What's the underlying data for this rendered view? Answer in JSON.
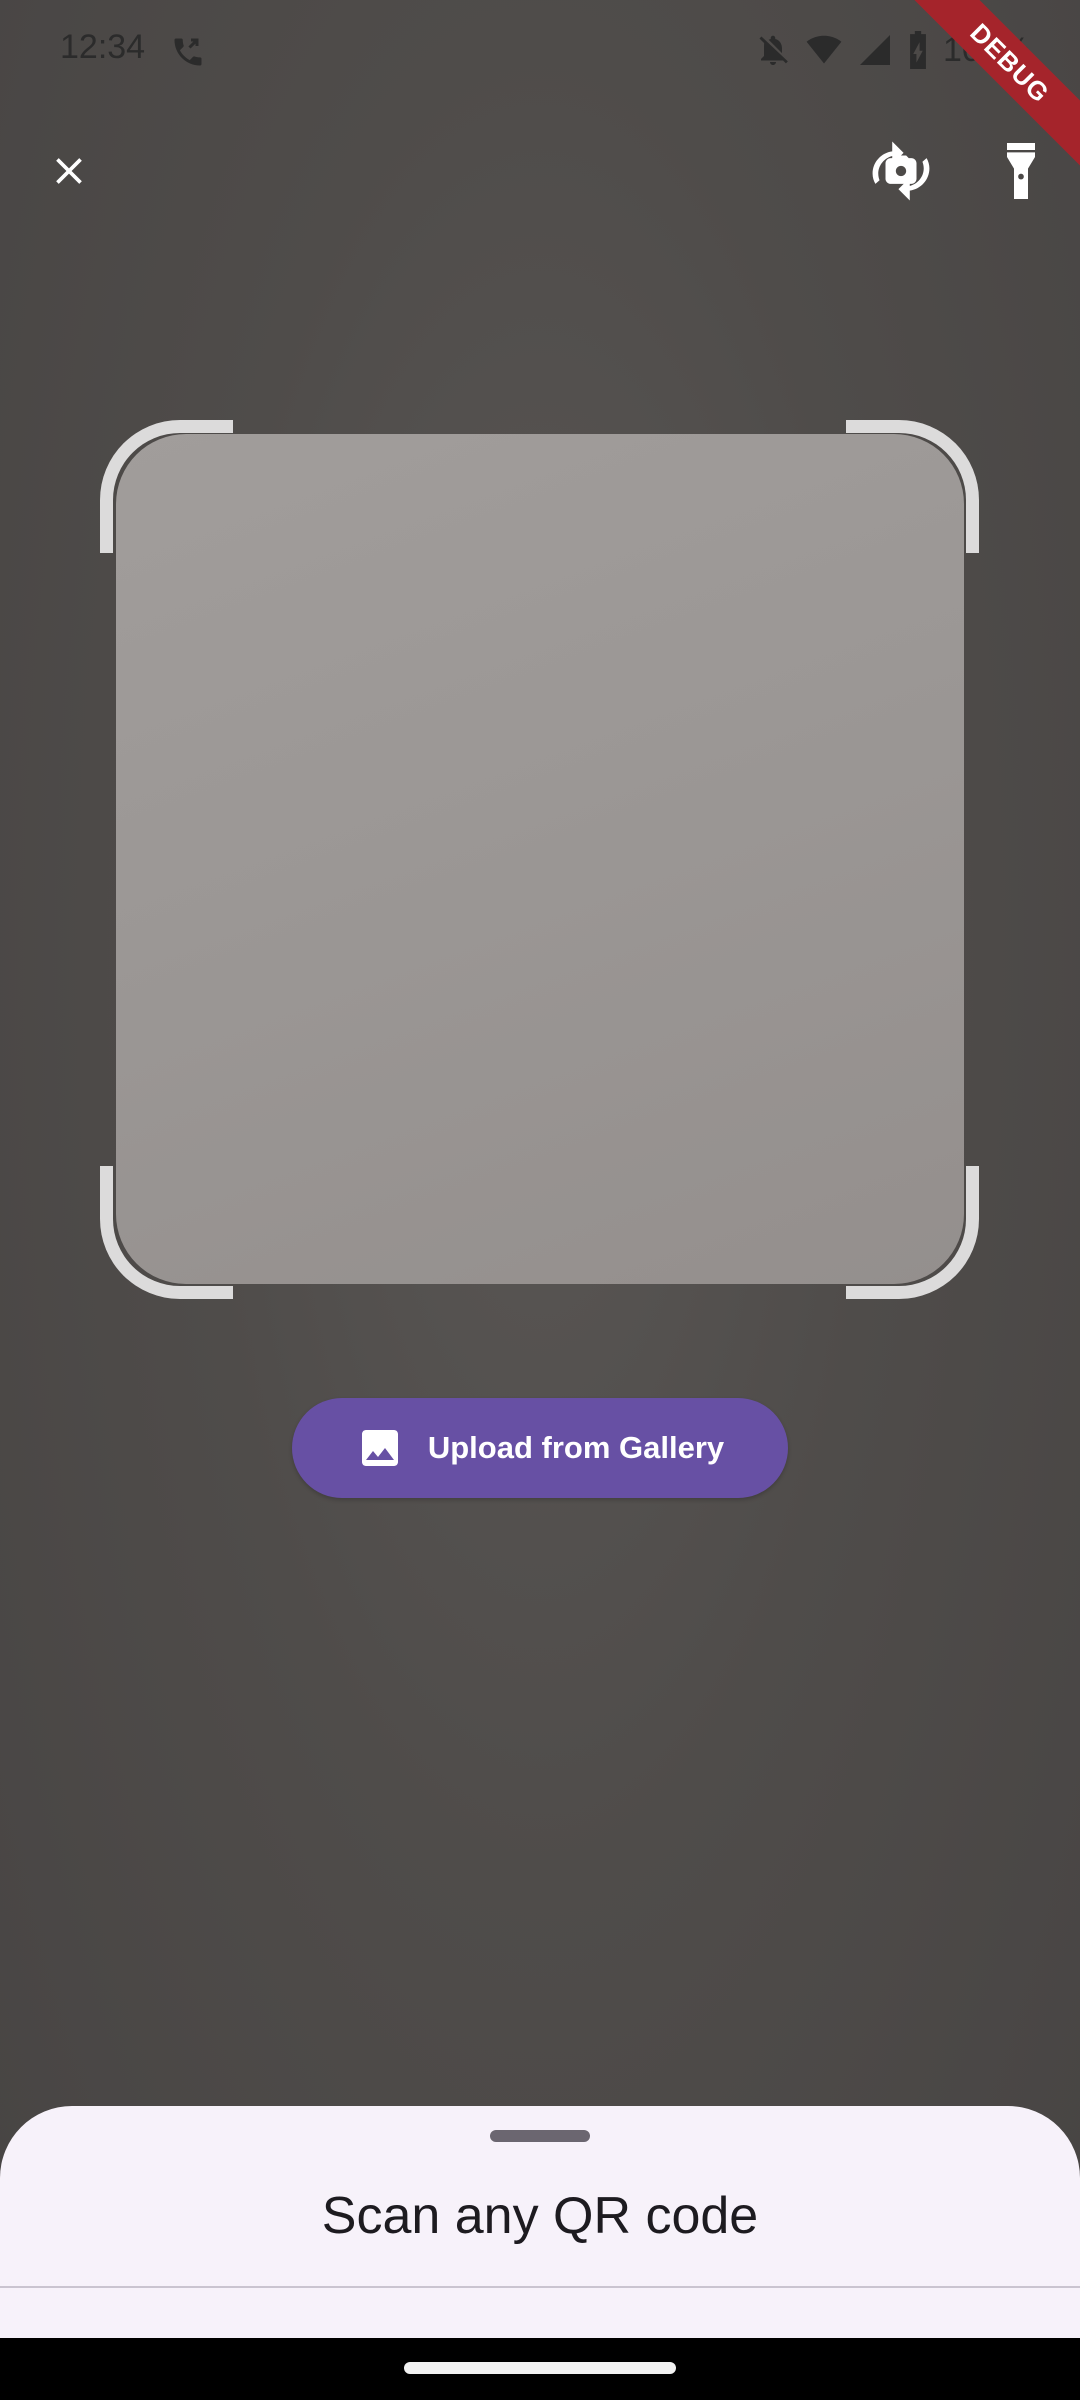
{
  "status_bar": {
    "time": "12:34",
    "battery_text": "100%",
    "debug_label": "DEBUG",
    "icons": [
      "call-forward-icon",
      "bell-off-icon",
      "wifi-icon",
      "signal-icon",
      "battery-charging-icon"
    ]
  },
  "toolbar": {
    "close_icon": "close-icon",
    "switch_camera_icon": "switch-camera-icon",
    "flashlight_icon": "flashlight-icon"
  },
  "upload": {
    "label": "Upload from Gallery",
    "icon": "image-icon",
    "color": "#6750a4"
  },
  "sheet": {
    "title": "Scan any QR code"
  }
}
